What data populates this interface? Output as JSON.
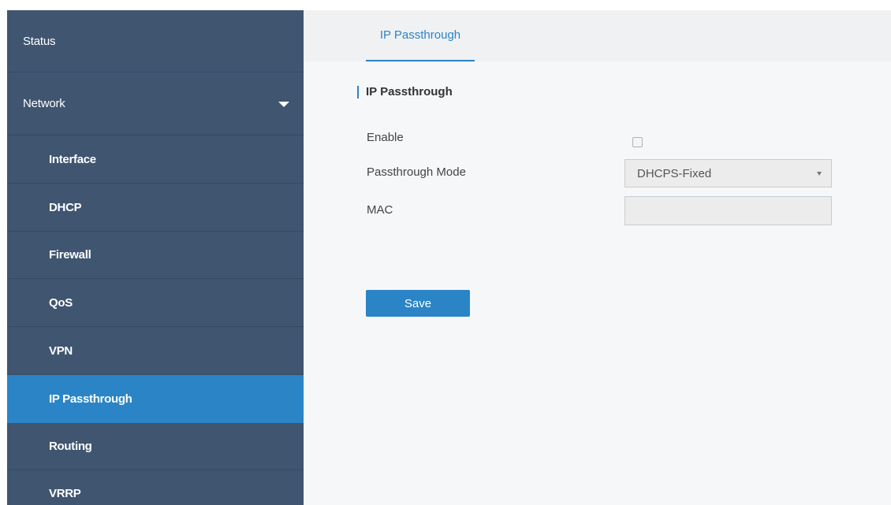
{
  "sidebar": {
    "items": [
      {
        "label": "Status"
      },
      {
        "label": "Network"
      },
      {
        "label": "Interface"
      },
      {
        "label": "DHCP"
      },
      {
        "label": "Firewall"
      },
      {
        "label": "QoS"
      },
      {
        "label": "VPN"
      },
      {
        "label": "IP Passthrough"
      },
      {
        "label": "Routing"
      },
      {
        "label": "VRRP"
      }
    ],
    "active": "IP Passthrough",
    "expanded": "Network"
  },
  "tabs": [
    {
      "label": "IP Passthrough",
      "active": true
    }
  ],
  "section": {
    "title": "IP Passthrough"
  },
  "form": {
    "enable": {
      "label": "Enable",
      "checked": false
    },
    "mode": {
      "label": "Passthrough Mode",
      "value": "DHCPS-Fixed"
    },
    "mac": {
      "label": "MAC",
      "value": ""
    }
  },
  "actions": {
    "save_label": "Save"
  },
  "colors": {
    "sidebar_bg": "#3f5570",
    "accent": "#2a84c6",
    "content_bg": "#f6f7f8"
  },
  "icons": {
    "network_expand": "caret-down-icon",
    "select_dropdown": "chevron-down-icon"
  }
}
